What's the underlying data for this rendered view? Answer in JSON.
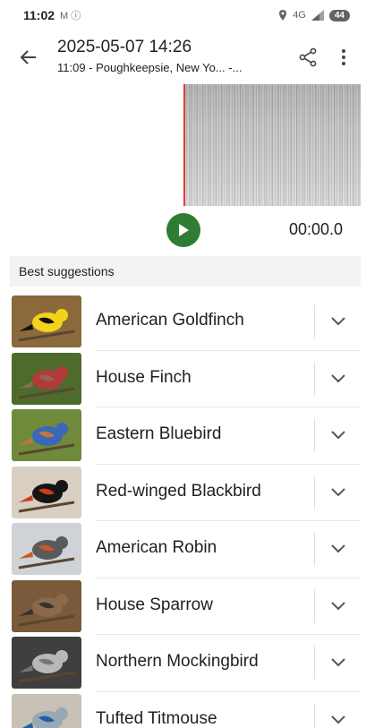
{
  "status_bar": {
    "time": "11:02",
    "left_icons": "M ⓘ",
    "network": "4G",
    "battery": "44"
  },
  "app_bar": {
    "title": "2025-05-07 14:26",
    "subtitle": "11:09 - Poughkeepsie, New Yo... -..."
  },
  "player": {
    "time": "00:00.0"
  },
  "suggestions": {
    "header": "Best suggestions",
    "items": [
      {
        "name": "American Goldfinch",
        "bg": "#8a6a3a",
        "body": "#f2d21b",
        "accent": "#111111"
      },
      {
        "name": "House Finch",
        "bg": "#4d6b2a",
        "body": "#b33a3a",
        "accent": "#8a6a55"
      },
      {
        "name": "Eastern Bluebird",
        "bg": "#6f8a3a",
        "body": "#3b67b8",
        "accent": "#c6753a"
      },
      {
        "name": "Red-winged Blackbird",
        "bg": "#d8cfc2",
        "body": "#151515",
        "accent": "#d23a1e"
      },
      {
        "name": "American Robin",
        "bg": "#cfd2d6",
        "body": "#5a5a5a",
        "accent": "#c85a28"
      },
      {
        "name": "House Sparrow",
        "bg": "#7a5a3a",
        "body": "#8a6a4a",
        "accent": "#333333"
      },
      {
        "name": "Northern Mockingbird",
        "bg": "#3f3f3f",
        "body": "#b8b8b8",
        "accent": "#777777"
      },
      {
        "name": "Tufted Titmouse",
        "bg": "#c9c0b6",
        "body": "#9aa7b5",
        "accent": "#1f5fa8"
      }
    ]
  }
}
